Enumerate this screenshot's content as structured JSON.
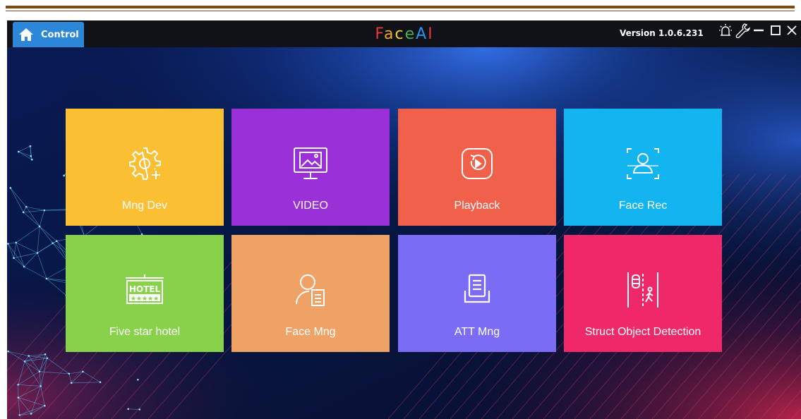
{
  "header": {
    "control_label": "Control",
    "title": "FaceAI",
    "title_letters": [
      {
        "ch": "F",
        "color": "#e53935"
      },
      {
        "ch": "a",
        "color": "#f5a623"
      },
      {
        "ch": "c",
        "color": "#f7d21c"
      },
      {
        "ch": "e",
        "color": "#4caf50"
      },
      {
        "ch": "A",
        "color": "#2196f3"
      },
      {
        "ch": "I",
        "color": "#e53935"
      }
    ],
    "version": "Version 1.0.6.231"
  },
  "window_controls": [
    "alarm-icon",
    "settings-wrench-icon",
    "minimize-icon",
    "maximize-icon",
    "close-icon"
  ],
  "tiles": [
    {
      "label": "Mng Dev",
      "color": "#fbbf33",
      "icon": "manage-device-gear-icon"
    },
    {
      "label": "VIDEO",
      "color": "#9a31d8",
      "icon": "video-monitor-icon"
    },
    {
      "label": "Playback",
      "color": "#f0604b",
      "icon": "playback-icon"
    },
    {
      "label": "Face Rec",
      "color": "#13b5f1",
      "icon": "face-recognition-icon"
    },
    {
      "label": "Five star hotel",
      "color": "#88d14a",
      "icon": "hotel-sign-icon"
    },
    {
      "label": "Face Mng",
      "color": "#eea265",
      "icon": "face-management-icon"
    },
    {
      "label": "ATT Mng",
      "color": "#7b6cf6",
      "icon": "attendance-icon"
    },
    {
      "label": "Struct Object Detection",
      "color": "#ef2869",
      "icon": "object-detection-icon"
    }
  ],
  "hotel_sign_text": "HOTEL",
  "hotel_stars": "★★★★★"
}
